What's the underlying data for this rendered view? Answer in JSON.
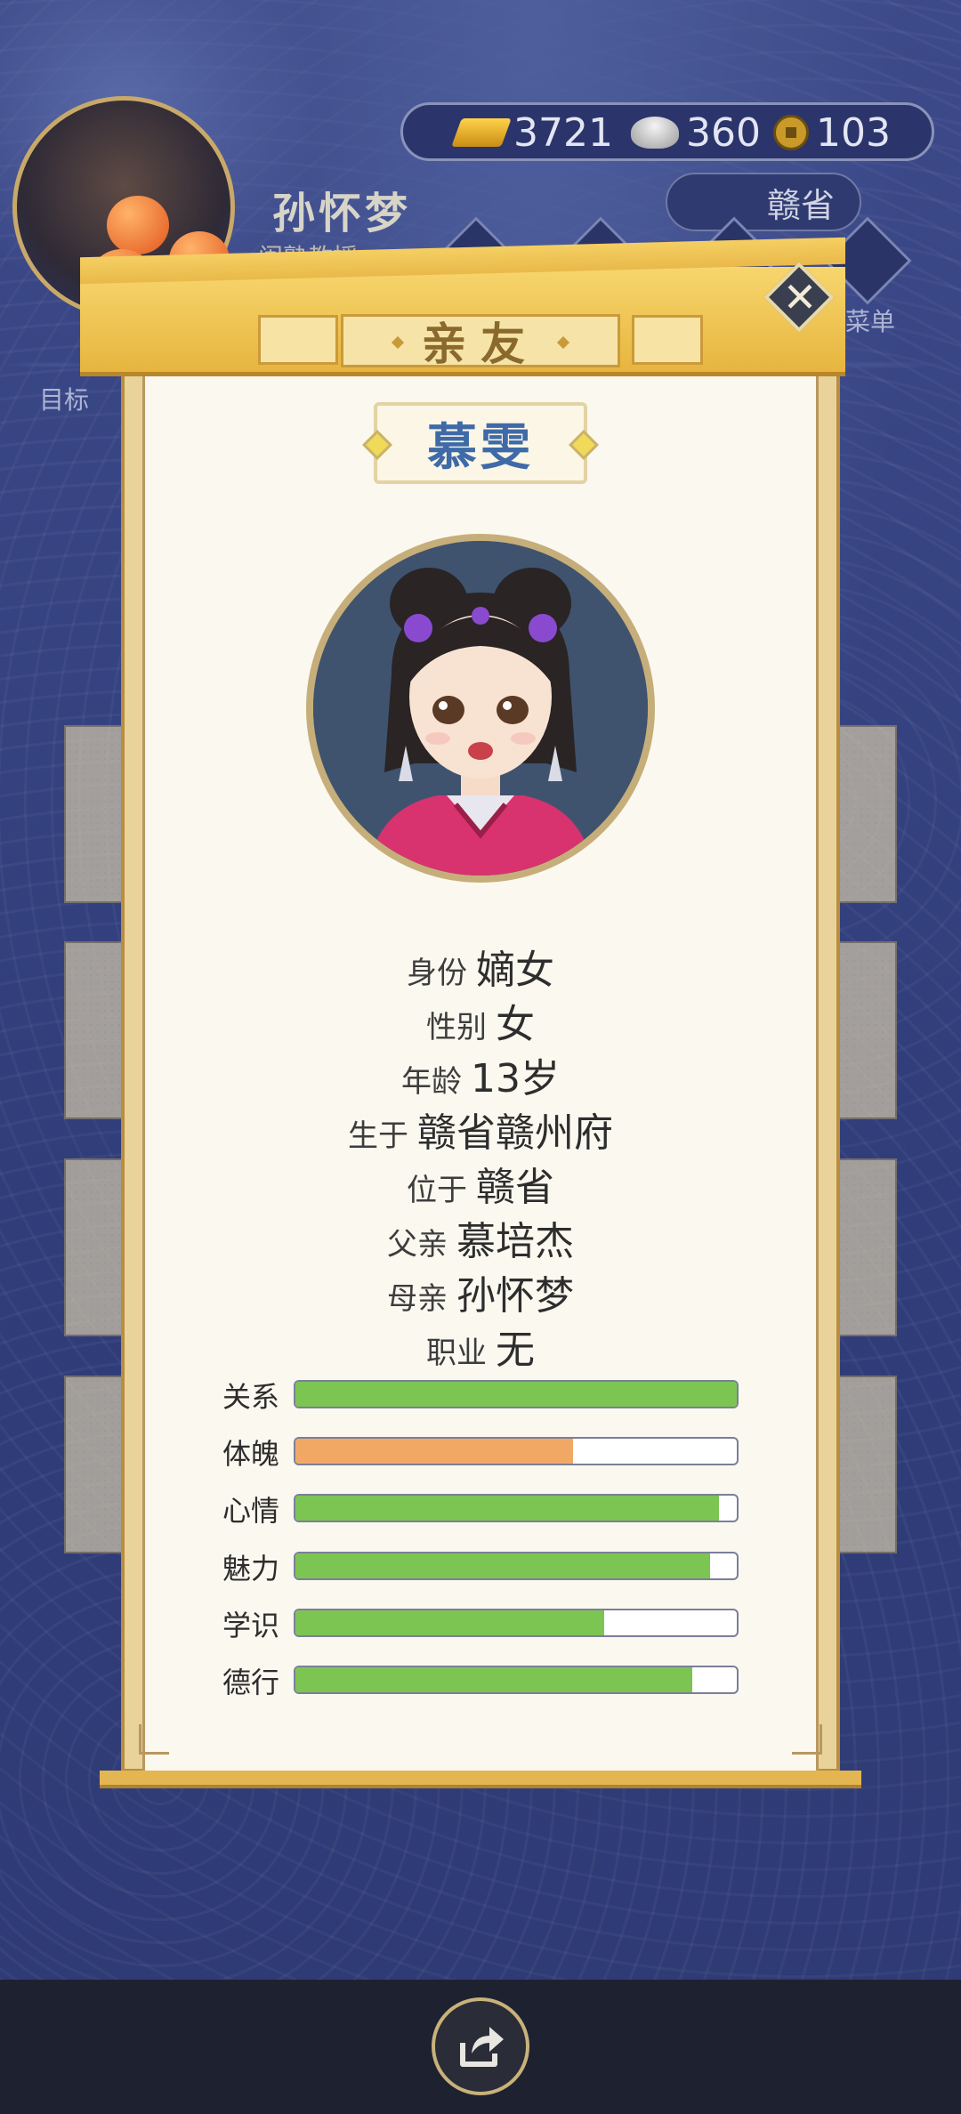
{
  "player": {
    "name": "孙怀梦",
    "title": "闺塾教授"
  },
  "currency": {
    "gold": "3721",
    "silver": "360",
    "coins": "103"
  },
  "location_button": "赣省",
  "nav": {
    "target_label": "目标",
    "menu_label": "菜单"
  },
  "dialog": {
    "title": "亲友",
    "close_icon": "close-icon"
  },
  "person": {
    "name": "慕雯",
    "fields": [
      {
        "label": "身份",
        "value": "嫡女"
      },
      {
        "label": "性别",
        "value": "女"
      },
      {
        "label": "年龄",
        "value": "13岁"
      },
      {
        "label": "生于",
        "value": "赣省赣州府"
      },
      {
        "label": "位于",
        "value": "赣省"
      },
      {
        "label": "父亲",
        "value": "慕培杰"
      },
      {
        "label": "母亲",
        "value": "孙怀梦"
      },
      {
        "label": "职业",
        "value": "无"
      }
    ],
    "stats": [
      {
        "label": "关系",
        "value": 1.0,
        "color": "#7cc552"
      },
      {
        "label": "体魄",
        "value": 0.63,
        "color": "#f2a865"
      },
      {
        "label": "心情",
        "value": 0.96,
        "color": "#7cc552"
      },
      {
        "label": "魅力",
        "value": 0.94,
        "color": "#7cc552"
      },
      {
        "label": "学识",
        "value": 0.7,
        "color": "#7cc552"
      },
      {
        "label": "德行",
        "value": 0.9,
        "color": "#7cc552"
      }
    ]
  },
  "bottom": {
    "share_icon": "share-icon"
  }
}
